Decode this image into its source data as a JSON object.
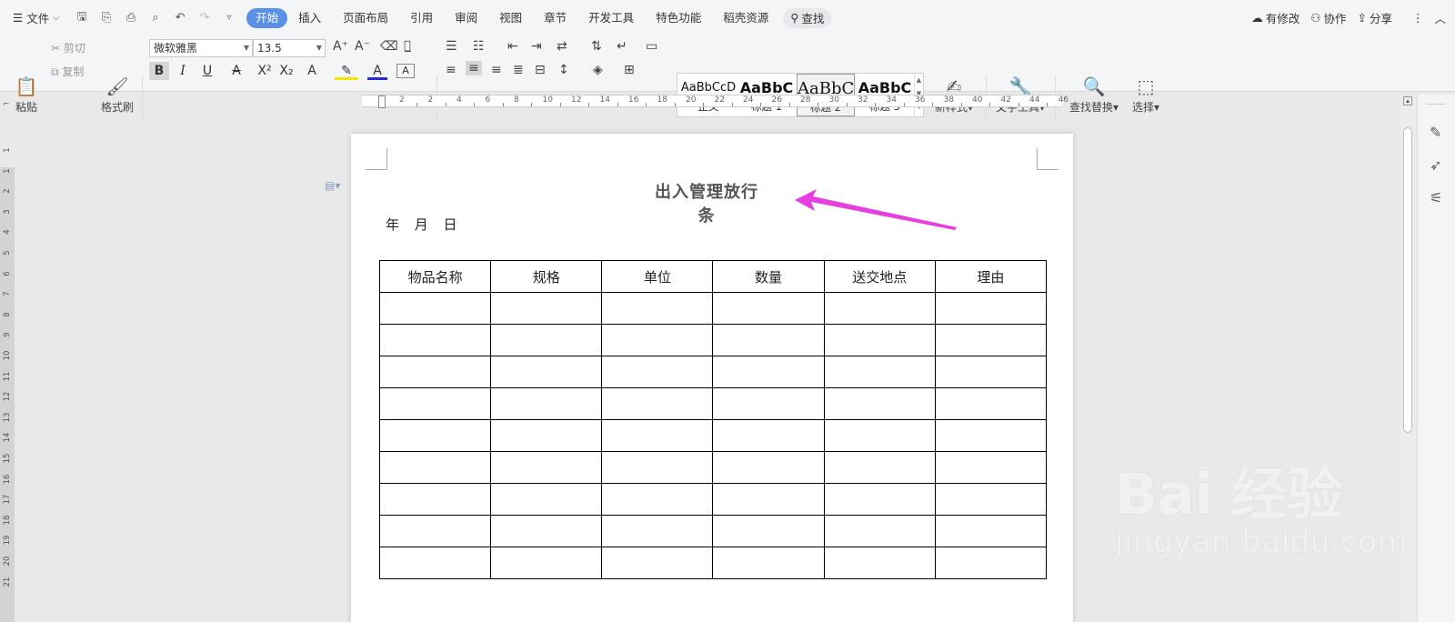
{
  "menubar": {
    "file_label": "文件",
    "tabs": [
      "开始",
      "插入",
      "页面布局",
      "引用",
      "审阅",
      "视图",
      "章节",
      "开发工具",
      "特色功能",
      "稻壳资源"
    ],
    "active_tab": "开始",
    "search_label": "查找",
    "right": {
      "changes": "有修改",
      "collab": "协作",
      "share": "分享"
    }
  },
  "ribbon": {
    "paste": "粘贴",
    "cut": "剪切",
    "copy": "复制",
    "format_painter": "格式刷",
    "font_name": "微软雅黑",
    "font_size": "13.5",
    "styles": [
      {
        "sample": "AaBbCcD",
        "name": "正文"
      },
      {
        "sample": "AaBbC",
        "name": "标题 1"
      },
      {
        "sample": "AaBbC",
        "name": "标题 2"
      },
      {
        "sample": "AaBbC",
        "name": "标题 3"
      }
    ],
    "selected_style": "标题 2",
    "new_style": "新样式",
    "text_tools": "文字工具",
    "find_replace": "查找替换",
    "select": "选择"
  },
  "ruler": {
    "h_labels": [
      "2",
      "2",
      "4",
      "6",
      "8",
      "10",
      "12",
      "14",
      "16",
      "18",
      "20",
      "22",
      "24",
      "26",
      "28",
      "30",
      "32",
      "34",
      "36",
      "38",
      "40",
      "42",
      "44",
      "46"
    ],
    "v_labels": [
      "1",
      "1",
      "2",
      "3",
      "4",
      "5",
      "6",
      "7",
      "8",
      "9",
      "10",
      "11",
      "12",
      "13",
      "14",
      "15",
      "16",
      "17",
      "18",
      "19",
      "20",
      "21"
    ]
  },
  "document": {
    "title": "出入管理放行条",
    "date_line": "年 月 日",
    "table": {
      "headers": [
        "物品名称",
        "规格",
        "单位",
        "数量",
        "送交地点",
        "理由"
      ],
      "rows": [
        [
          "",
          "",
          "",
          "",
          "",
          ""
        ],
        [
          "",
          "",
          "",
          "",
          "",
          ""
        ],
        [
          "",
          "",
          "",
          "",
          "",
          ""
        ],
        [
          "",
          "",
          "",
          "",
          "",
          ""
        ],
        [
          "",
          "",
          "",
          "",
          "",
          ""
        ],
        [
          "",
          "",
          "",
          "",
          "",
          ""
        ],
        [
          "",
          "",
          "",
          "",
          "",
          ""
        ],
        [
          "",
          "",
          "",
          "",
          "",
          ""
        ],
        [
          "",
          "",
          "",
          "",
          "",
          ""
        ]
      ]
    }
  },
  "annotation": {
    "color": "#e63ee0"
  },
  "watermark": {
    "logo": "Bai 经验",
    "url": "jingyan.baidu.com"
  }
}
